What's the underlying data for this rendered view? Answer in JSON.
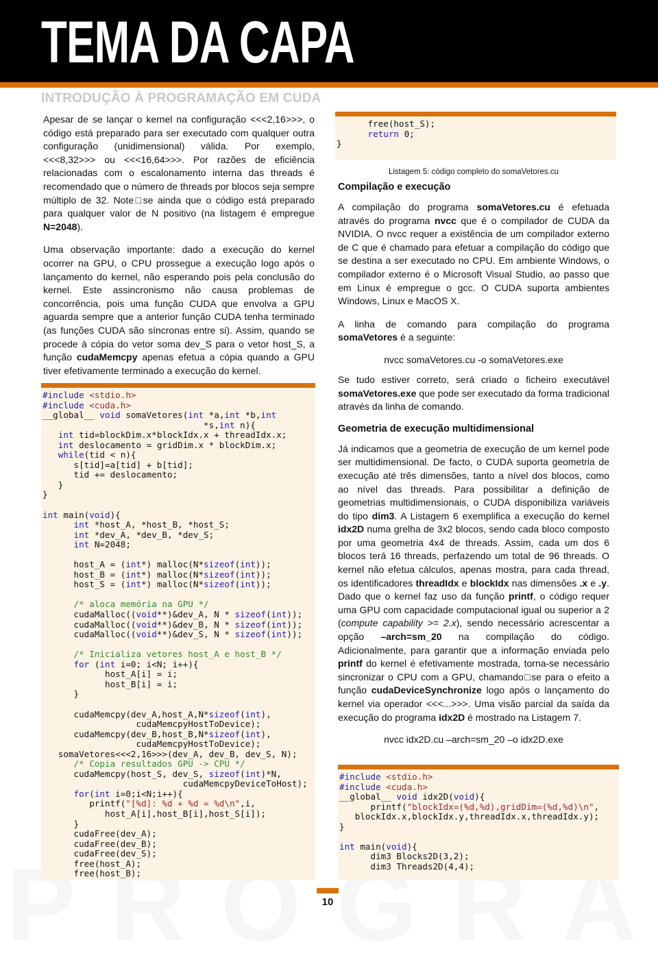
{
  "header": {
    "title": "TEMA DA CAPA",
    "section_title": "INTRODUÇÃO À PROGRAMAÇÃO EM CUDA",
    "accent_color": "#d9720c"
  },
  "watermark": "PROGRAMAR",
  "left": {
    "p1": {
      "a": "Apesar de se lançar o kernel na configuração <<<2,16>>>, o código está preparado para ser executado com qualquer outra configuração (unidimensional) válida. Por exemplo, <<<8,32>>> ou <<<16,64>>>. Por razões de eficiência relacionadas com o escalonamento interna das threads é recomendado que o número de threads por blocos seja sempre múltiplo de 32. Note□se ainda que o código está preparado para qualquer valor de N positivo (na listagem é empregue ",
      "b": "N=2048",
      "c": ")."
    },
    "p2": {
      "a": "Uma observação importante: dado a execução do kernel ocorrer na GPU, o CPU prossegue a execução logo após o lançamento do kernel, não esperando pois pela conclusão do kernel. Este assincronismo não causa problemas de concorrência, pois uma função CUDA que envolva a GPU aguarda sempre que a anterior função CUDA tenha terminado (as funções CUDA são síncronas entre si). Assim, quando se procede à cópia do vetor soma dev_S para o vetor host_S, a função ",
      "b": "cudaMemcpy",
      "c": " apenas efetua a cópia quando a GPU tiver efetivamente terminado a execução do kernel."
    }
  },
  "listing5": {
    "lines": [
      "#include <stdio.h>",
      "#include <cuda.h>",
      "__global__ void somaVetores(int *a,int *b,int",
      "                               *s,int n){",
      "   int tid=blockDim.x*blockIdx.x + threadIdx.x;",
      "   int deslocamento = gridDim.x * blockDim.x;",
      "   while(tid < n){",
      "      s[tid]=a[tid] + b[tid];",
      "      tid += deslocamento;",
      "   }",
      "}",
      "",
      "int main(void){",
      "      int *host_A, *host_B, *host_S;",
      "      int *dev_A, *dev_B, *dev_S;",
      "      int N=2048;",
      "",
      "      host_A = (int*) malloc(N*sizeof(int));",
      "      host_B = (int*) malloc(N*sizeof(int));",
      "      host_S = (int*) malloc(N*sizeof(int));",
      "",
      "      /* aloca memória na GPU */",
      "      cudaMalloc((void**)&dev_A, N * sizeof(int));",
      "      cudaMalloc((void**)&dev_B, N * sizeof(int));",
      "      cudaMalloc((void**)&dev_S, N * sizeof(int));",
      "",
      "      /* Inicializa vetores host_A e host_B */",
      "      for (int i=0; i<N; i++){",
      "            host_A[i] = i;",
      "            host_B[i] = i;",
      "      }",
      "",
      "      cudaMemcpy(dev_A,host_A,N*sizeof(int),",
      "                  cudaMemcpyHostToDevice);",
      "      cudaMemcpy(dev_B,host_B,N*sizeof(int),",
      "                  cudaMemcpyHostToDevice);",
      "   somaVetores<<<2,16>>>(dev_A, dev_B, dev_S, N);",
      "      /* Copia resultados GPU -> CPU */",
      "      cudaMemcpy(host_S, dev_S, sizeof(int)*N,",
      "                           cudaMemcpyDeviceToHost);",
      "      for(int i=0;i<N;i++){",
      "         printf(\"[%d]: %d + %d = %d\\n\",i,",
      "            host_A[i],host_B[i],host_S[i]);",
      "      }",
      "      cudaFree(dev_A);",
      "      cudaFree(dev_B);",
      "      cudaFree(dev_S);",
      "      free(host_A);",
      "      free(host_B);"
    ],
    "continuation": [
      "      free(host_S);",
      "      return 0;",
      "}"
    ],
    "caption": "Listagem 5: código completo do somaVetores.cu"
  },
  "right": {
    "heading1": "Compilação e execução",
    "p1": {
      "a": "A compilação do programa ",
      "b": "somaVetores.cu",
      "c": " é efetuada através do programa ",
      "d": "nvcc",
      "e": " que é o compilador de CUDA da NVIDIA. O nvcc requer a existência de um compilador externo de C que é chamado para efetuar a compilação do código que se destina a ser executado no CPU. Em ambiente Windows, o compilador externo é o Microsoft Visual Studio, ao passo que em Linux é empregue o gcc. O CUDA suporta ambientes Windows, Linux e MacOS X."
    },
    "p2": {
      "a": "A linha de comando para compilação do programa ",
      "b": "somaVetores",
      "c": " é a seguinte:"
    },
    "cmd1": "nvcc somaVetores.cu -o somaVetores.exe",
    "p3": {
      "a": "Se tudo estiver correto, será criado o ficheiro executável ",
      "b": "somaVetores.exe",
      "c": " que pode ser executado da forma tradicional através da linha de comando."
    },
    "heading2": "Geometria de execução multidimensional",
    "p4": {
      "a": "Já indicamos que a geometria de execução de um kernel pode ser multidimensional. De facto, o CUDA suporta geometria de execução até três dimensões, tanto a nível dos blocos, como ao nível das threads. Para possibilitar a definição de geometrias multidimensionais, o CUDA disponibiliza variáveis do tipo ",
      "b": "dim3",
      "c": ". A Listagem 6 exemplifica a execução do kernel ",
      "d": "idx2D",
      "e": " numa grelha de 3x2 blocos, sendo cada bloco composto por uma geometria 4x4 de threads. Assim, cada um dos 6 blocos terá 16 threads, perfazendo um total de 96 threads. O kernel não efetua cálculos, apenas mostra, para cada thread, os identificadores ",
      "f": "threadIdx",
      "g": " e ",
      "h": "blockIdx",
      "i": " nas dimensões ",
      "j": ".x",
      "k": " e ",
      "l": ".y",
      "m": ". Dado que o kernel faz uso da função ",
      "n": "printf",
      "o": ", o código requer uma GPU com capacidade computacional igual ou superior a 2 (",
      "p": "compute capability >= 2.x",
      "q": "), sendo necessário acrescentar a opção ",
      "r": "–arch=sm_20",
      "s": " na compilação do código. Adicionalmente, para garantir que a informação enviada pelo ",
      "t": "printf",
      "u": " do kernel é efetivamente mostrada, torna-se necessário sincronizar o CPU com a GPU, chamando□se para o efeito a função ",
      "v": "cudaDeviceSynchronize",
      "w": " logo após o lançamento do kernel via operador <<<...>>>. Uma visão parcial da saída da execução do programa ",
      "x": "idx2D",
      "y": " é mostrado na Listagem 7."
    },
    "cmd2": "nvcc idx2D.cu –arch=sm_20 –o idx2D.exe"
  },
  "listing6": {
    "lines": [
      "#include <stdio.h>",
      "#include <cuda.h>",
      "__global__ void idx2D(void){",
      "      printf(\"blockIdx=(%d,%d),gridDim=(%d,%d)\\n\",",
      "   blockIdx.x,blockIdx.y,threadIdx.x,threadIdx.y);",
      "}",
      "",
      "int main(void){",
      "      dim3 Blocks2D(3,2);",
      "      dim3 Threads2D(4,4);"
    ]
  },
  "footer": {
    "page_number": "10"
  }
}
